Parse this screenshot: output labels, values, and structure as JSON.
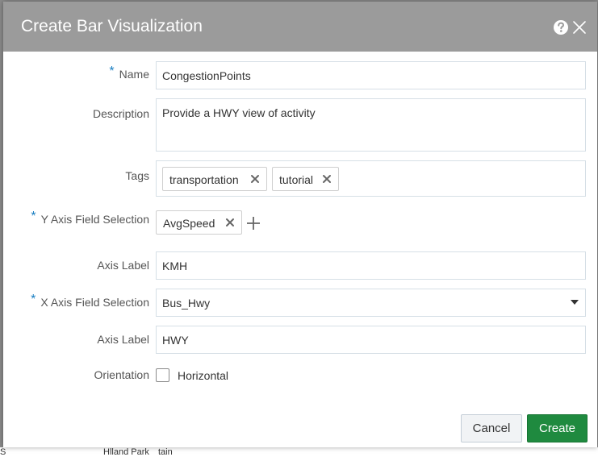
{
  "background": {
    "bottom_text": [
      "S",
      "Hlland Park",
      "tain"
    ]
  },
  "dialog": {
    "title": "Create Bar Visualization",
    "colors": {
      "header": "#9b9b9b",
      "accent": "#1a7fc2",
      "primary_button": "#1f8a3f"
    }
  },
  "form": {
    "required_mark": "*",
    "name": {
      "label": "Name",
      "value": "CongestionPoints"
    },
    "description": {
      "label": "Description",
      "value": "Provide a HWY view of activity"
    },
    "tags": {
      "label": "Tags",
      "items": [
        "transportation",
        "tutorial"
      ]
    },
    "y_axis": {
      "label": "Y Axis Field Selection",
      "items": [
        "AvgSpeed"
      ],
      "axis_label_label": "Axis Label",
      "axis_label_value": "KMH"
    },
    "x_axis": {
      "label": "X Axis Field Selection",
      "selected": "Bus_Hwy",
      "axis_label_label": "Axis Label",
      "axis_label_value": "HWY"
    },
    "orientation": {
      "label": "Orientation",
      "option": "Horizontal",
      "checked": false
    }
  },
  "footer": {
    "cancel_label": "Cancel",
    "create_label": "Create"
  },
  "icons": [
    "help-icon",
    "close-icon",
    "remove-tag-icon",
    "add-icon",
    "chevron-down-icon"
  ]
}
